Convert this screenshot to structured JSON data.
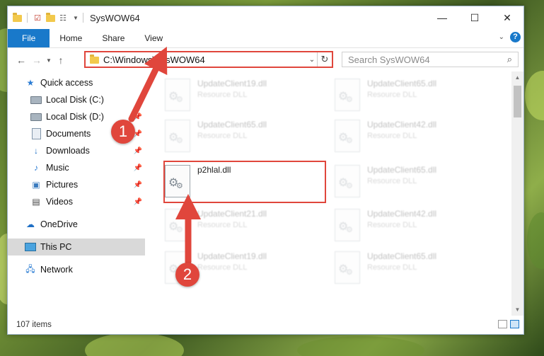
{
  "titlebar": {
    "title": "SysWOW64",
    "minimize_glyph": "—",
    "maximize_glyph": "☐",
    "close_glyph": "✕"
  },
  "ribbon": {
    "tabs": [
      {
        "label": "File"
      },
      {
        "label": "Home"
      },
      {
        "label": "Share"
      },
      {
        "label": "View"
      }
    ],
    "help_label": "?"
  },
  "nav": {
    "address": "C:\\Windows\\SysWOW64",
    "search_placeholder": "Search SysWOW64"
  },
  "sidebar": {
    "items": [
      {
        "label": "Quick access",
        "icon": "star-icon",
        "pinned": false
      },
      {
        "label": "Local Disk (C:)",
        "icon": "drive-icon",
        "pinned": false
      },
      {
        "label": "Local Disk (D:)",
        "icon": "drive-icon",
        "pinned": true
      },
      {
        "label": "Documents",
        "icon": "documents-icon",
        "pinned": true
      },
      {
        "label": "Downloads",
        "icon": "download-icon",
        "pinned": true
      },
      {
        "label": "Music",
        "icon": "music-icon",
        "pinned": true
      },
      {
        "label": "Pictures",
        "icon": "pictures-icon",
        "pinned": true
      },
      {
        "label": "Videos",
        "icon": "videos-icon",
        "pinned": true
      },
      {
        "label": "OneDrive",
        "icon": "cloud-icon",
        "pinned": false
      },
      {
        "label": "This PC",
        "icon": "computer-icon",
        "pinned": false,
        "selected": true
      },
      {
        "label": "Network",
        "icon": "network-icon",
        "pinned": false
      }
    ]
  },
  "files": {
    "left": [
      {
        "name": "UpdateClient19.dll",
        "type": "Resource DLL"
      },
      {
        "name": "UpdateClient65.dll",
        "type": "Resource DLL"
      },
      {
        "name": "p2hlal.dll",
        "type": ""
      },
      {
        "name": "UpdateClient21.dll",
        "type": "Resource DLL"
      },
      {
        "name": "UpdateClient19.dll",
        "type": "Resource DLL"
      }
    ],
    "right": [
      {
        "name": "UpdateClient65.dll",
        "type": "Resource DLL"
      },
      {
        "name": "UpdateClient42.dll",
        "type": "Resource DLL"
      },
      {
        "name": "UpdateClient65.dll",
        "type": "Resource DLL"
      },
      {
        "name": "UpdateClient42.dll",
        "type": "Resource DLL"
      },
      {
        "name": "UpdateClient65.dll",
        "type": "Resource DLL"
      }
    ]
  },
  "status": {
    "item_count": "107 items"
  },
  "annotations": {
    "step1": "1",
    "step2": "2",
    "color": "#e0463c"
  }
}
